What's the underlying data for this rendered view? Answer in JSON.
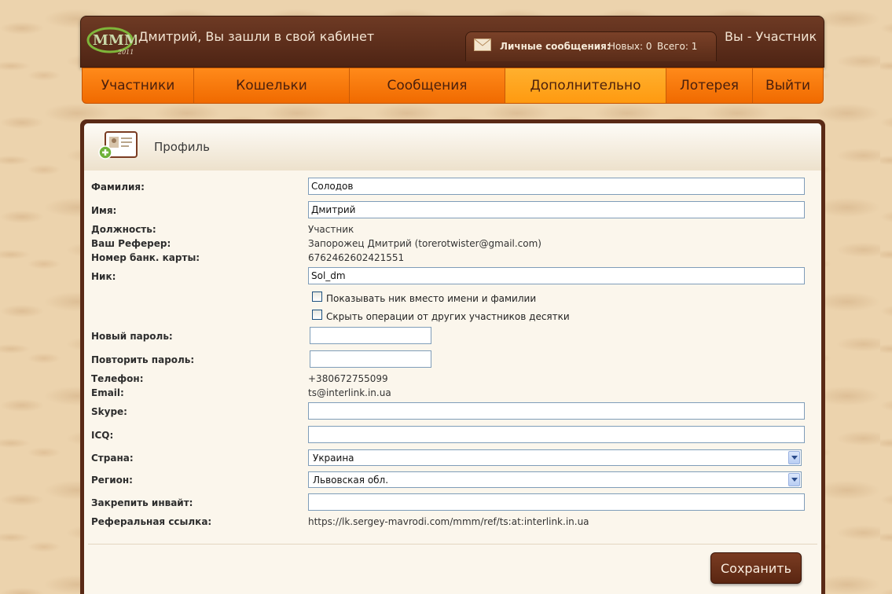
{
  "header": {
    "logo_text": "МММ",
    "logo_year": "2011",
    "welcome": "Дмитрий, Вы зашли в свой кабинет",
    "messages_label": "Личные сообщения:",
    "messages_new": "Новых: 0",
    "messages_total": "Всего: 1",
    "role": "Вы - Участник"
  },
  "nav": {
    "items": [
      {
        "label": "Участники"
      },
      {
        "label": "Кошельки"
      },
      {
        "label": "Сообщения"
      },
      {
        "label": "Дополнительно",
        "active": true
      },
      {
        "label": "Лотерея"
      },
      {
        "label": "Выйти"
      }
    ]
  },
  "profile": {
    "title": "Профиль",
    "fields": {
      "last_name_label": "Фамилия:",
      "last_name_value": "Солодов",
      "first_name_label": "Имя:",
      "first_name_value": "Дмитрий",
      "position_label": "Должность:",
      "position_value": "Участник",
      "referrer_label": "Ваш Реферер:",
      "referrer_value": "Запорожец Дмитрий (torerotwister@gmail.com)",
      "card_label": "Номер банк. карты:",
      "card_value": "6762462602421551",
      "nick_label": "Ник:",
      "nick_value": "Sol_dm",
      "show_nick_label": "Показывать ник вместо имени и фамилии",
      "hide_ops_label": "Скрыть операции от других участников десятки",
      "new_password_label": "Новый пароль:",
      "repeat_password_label": "Повторить пароль:",
      "phone_label": "Телефон:",
      "phone_value": "+380672755099",
      "email_label": "Email:",
      "email_value": "ts@interlink.in.ua",
      "skype_label": "Skype:",
      "skype_value": "",
      "icq_label": "ICQ:",
      "icq_value": "",
      "country_label": "Страна:",
      "country_value": "Украина",
      "region_label": "Регион:",
      "region_value": "Львовская обл.",
      "invite_label": "Закрепить инвайт:",
      "invite_value": "",
      "ref_link_label": "Реферальная ссылка:",
      "ref_link_value": "https://lk.sergey-mavrodi.com/mmm/ref/ts:at:interlink.in.ua"
    },
    "save_label": "Сохранить"
  },
  "colors": {
    "header_brown": "#5a2c18",
    "nav_orange": "#f57a0a",
    "nav_active": "#ffa21e",
    "panel_bg": "#fbf6ec"
  }
}
